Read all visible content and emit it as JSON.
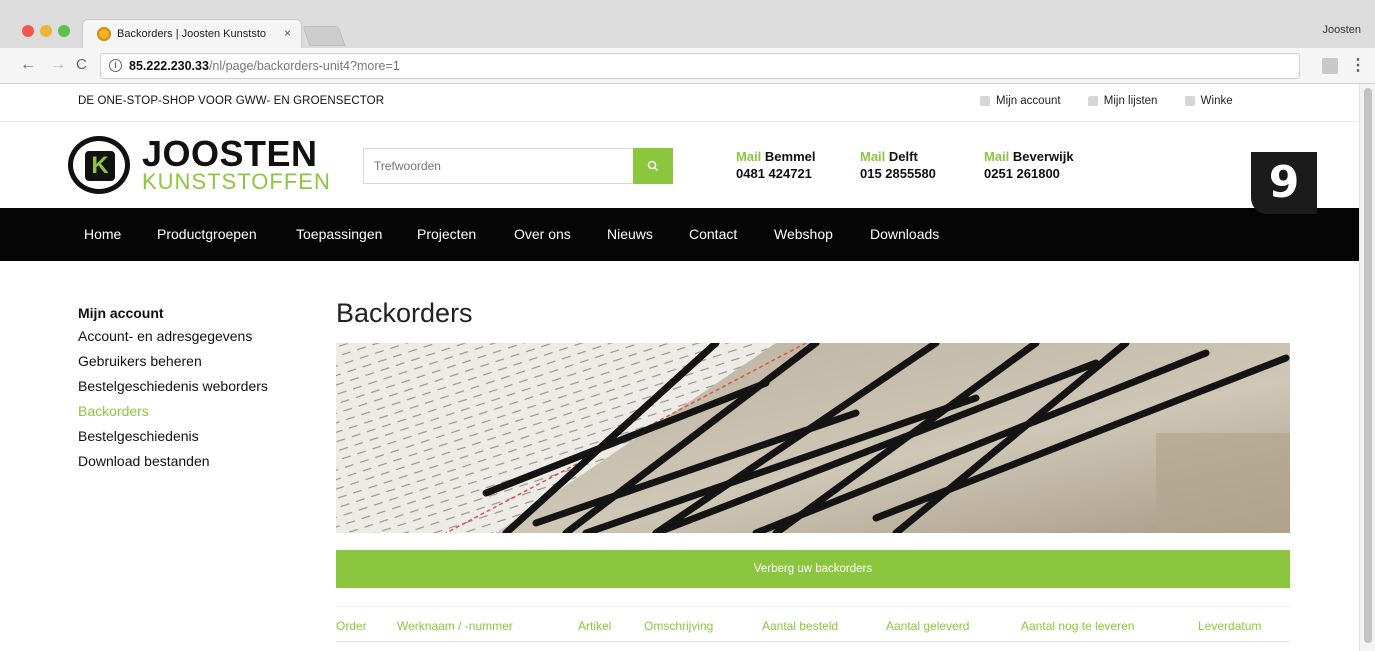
{
  "browser": {
    "tab_title": "Backorders | Joosten Kunststo",
    "tab_close": "×",
    "profile_name": "Joosten",
    "url_host": "85.222.230.33",
    "url_path": "/nl/page/backorders-unit4?more=1",
    "back_glyph": "←",
    "forward_glyph": "→",
    "reload_glyph": "C",
    "menu_glyph": "⋮"
  },
  "topbar": {
    "tagline": "DE ONE-STOP-SHOP VOOR GWW- EN GROENSECTOR",
    "links": [
      "Mijn account",
      "Mijn lijsten",
      "Winke"
    ]
  },
  "badge": {
    "number": "9"
  },
  "header": {
    "logo_name": "JOOSTEN",
    "logo_sub": "KUNSTSTOFFEN",
    "logo_mark": "K",
    "search_placeholder": "Trefwoorden",
    "search_icon": "search-icon",
    "contacts": [
      {
        "mail": "Mail",
        "city": "Bemmel",
        "phone": "0481 424721"
      },
      {
        "mail": "Mail",
        "city": "Delft",
        "phone": "015 2855580"
      },
      {
        "mail": "Mail",
        "city": "Beverwijk",
        "phone": "0251 261800"
      }
    ]
  },
  "nav": [
    "Home",
    "Productgroepen",
    "Toepassingen",
    "Projecten",
    "Over ons",
    "Nieuws",
    "Contact",
    "Webshop",
    "Downloads"
  ],
  "sidebar": {
    "title": "Mijn account",
    "items": [
      "Account- en adresgegevens",
      "Gebruikers beheren",
      "Bestelgeschiedenis weborders",
      "Backorders",
      "Bestelgeschiedenis",
      "Download bestanden"
    ],
    "active_index": 3
  },
  "main": {
    "title": "Backorders",
    "toggle_label": "Verberg uw backorders",
    "columns": [
      "Order",
      "Werknaam / -nummer",
      "Artikel",
      "Omschrijving",
      "Aantal besteld",
      "Aantal geleverd",
      "Aantal nog te leveren",
      "Leverdatum"
    ]
  },
  "colors": {
    "accent": "#8cc63f",
    "nav_bg": "#050505"
  }
}
